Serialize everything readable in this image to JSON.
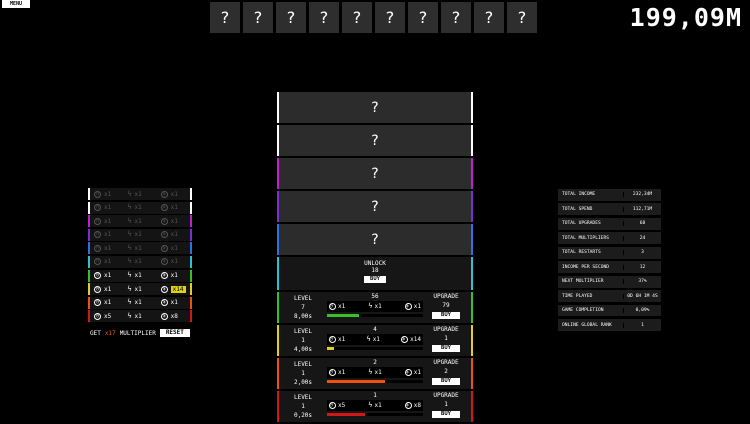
{
  "menu_label": "MENU",
  "money": "199,09M",
  "top_slots": [
    "?",
    "?",
    "?",
    "?",
    "?",
    "?",
    "?",
    "?",
    "?",
    "?"
  ],
  "locked": [
    {
      "label": "?",
      "color": "#ffffff"
    },
    {
      "label": "?",
      "color": "#ffffff"
    },
    {
      "label": "?",
      "color": "#c020d0"
    },
    {
      "label": "?",
      "color": "#7830d0"
    },
    {
      "label": "?",
      "color": "#3070e0"
    }
  ],
  "unlock": {
    "title": "UNLOCK",
    "cost": "18",
    "buy": "BUY",
    "color": "#30c0d0"
  },
  "generators": [
    {
      "level_label": "LEVEL",
      "level": "7",
      "time": "8,00s",
      "amount": "56",
      "speed": "x1",
      "power": "x1",
      "money": "x1",
      "progress": 0.33,
      "upgrade_label": "UPGRADE",
      "upgrade_cost": "79",
      "buy": "BUY",
      "color": "#38c028"
    },
    {
      "level_label": "LEVEL",
      "level": "1",
      "time": "4,00s",
      "amount": "4",
      "speed": "x1",
      "power": "x1",
      "money": "x14",
      "progress": 0.07,
      "upgrade_label": "UPGRADE",
      "upgrade_cost": "1",
      "buy": "BUY",
      "color": "#e0d020"
    },
    {
      "level_label": "LEVEL",
      "level": "1",
      "time": "2,00s",
      "amount": "2",
      "speed": "x1",
      "power": "x1",
      "money": "x1",
      "progress": 0.6,
      "upgrade_label": "UPGRADE",
      "upgrade_cost": "2",
      "buy": "BUY",
      "color": "#f05010"
    },
    {
      "level_label": "LEVEL",
      "level": "1",
      "time": "0,20s",
      "amount": "1",
      "speed": "x5",
      "power": "x1",
      "money": "x8",
      "progress": 0.4,
      "upgrade_label": "UPGRADE",
      "upgrade_cost": "1",
      "buy": "BUY",
      "color": "#d01818"
    }
  ],
  "multipliers": [
    {
      "color": "#ffffff",
      "active": false,
      "a": "x1",
      "b": "x1",
      "c": "x1"
    },
    {
      "color": "#ffffff",
      "active": false,
      "a": "x1",
      "b": "x1",
      "c": "x1"
    },
    {
      "color": "#c020d0",
      "active": false,
      "a": "x1",
      "b": "x1",
      "c": "x1"
    },
    {
      "color": "#7830d0",
      "active": false,
      "a": "x1",
      "b": "x1",
      "c": "x1"
    },
    {
      "color": "#3070e0",
      "active": false,
      "a": "x1",
      "b": "x1",
      "c": "x1"
    },
    {
      "color": "#30c0d0",
      "active": false,
      "a": "x1",
      "b": "x1",
      "c": "x1"
    },
    {
      "color": "#38c028",
      "active": true,
      "a": "x1",
      "b": "x1",
      "c": "x1"
    },
    {
      "color": "#e0d020",
      "active": true,
      "a": "x1",
      "b": "x1",
      "c": "x14",
      "highlight": true
    },
    {
      "color": "#f05010",
      "active": true,
      "a": "x1",
      "b": "x1",
      "c": "x1"
    },
    {
      "color": "#d01818",
      "active": true,
      "a": "x5",
      "b": "x1",
      "c": "x8"
    }
  ],
  "reset": {
    "get": "GET",
    "value": "x17",
    "suffix": "MULTIPLIER",
    "button": "RESET"
  },
  "stats": [
    {
      "k": "TOTAL INCOME",
      "v": "232,34M"
    },
    {
      "k": "TOTAL SPEND",
      "v": "112,71M"
    },
    {
      "k": "TOTAL UPGRADES",
      "v": "68"
    },
    {
      "k": "TOTAL MULTIPLIERS",
      "v": "24"
    },
    {
      "k": "TOTAL RESTARTS",
      "v": "3"
    },
    {
      "k": "INCOME PER SECOND",
      "v": "12"
    },
    {
      "k": "NEXT MULTIPLIER",
      "v": "37%"
    },
    {
      "k": "TIME PLAYED",
      "v": "0D 6H 1M 4S"
    },
    {
      "k": "GAME COMPLETION",
      "v": "0,09%"
    },
    {
      "k": "ONLINE GLOBAL RANK",
      "v": "1"
    }
  ]
}
